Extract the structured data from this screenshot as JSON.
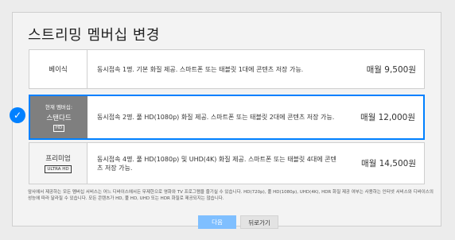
{
  "title": "스트리밍 멤버십 변경",
  "plans": [
    {
      "name": "베이식",
      "description": "동시접속 1명. 기본 화질 제공. 스마트폰 또는 태블릿 1대에 콘텐츠 저장 가능.",
      "price": "매월 9,500원"
    },
    {
      "current_label": "현재 멤버십:",
      "name": "스탠다드",
      "badge": "HD",
      "description": "동시접속 2명. 풀 HD(1080p) 화질 제공. 스마트폰 또는 태블릿 2대에 콘텐츠 저장 가능.",
      "price": "매월 12,000원"
    },
    {
      "name": "프리미엄",
      "badge": "ULTRA HD",
      "description": "동시접속 4명. 풀 HD(1080p) 및 UHD(4K) 화질 제공. 스마트폰 또는 태블릿 4대에 콘텐츠 저장 가능.",
      "price": "매월 14,500원"
    }
  ],
  "selected_check": "✓",
  "footnote": "앞사에서 제공하는 모든 멤버십 서비스는 어느 디바이스에서든 무제한으로 영화와 TV 프로그램을 즐기실 수 있습니다. HD(720p), 풀 HD(1080p), UHD(4K), HDR 화질 제공 여부는 사용하는 인터넷 서비스와 디바이스의 성능에 따라 달라질 수 있습니다. 모든 콘텐츠가 HD, 풀 HD, UHD 또는 HDR 화질로 제공되지는 않습니다.",
  "buttons": {
    "next": "다음",
    "back": "뒤로가기"
  },
  "colors": {
    "accent": "#0080ff",
    "next_button": "#7fbfff",
    "selected_panel": "#7f7f7f"
  }
}
